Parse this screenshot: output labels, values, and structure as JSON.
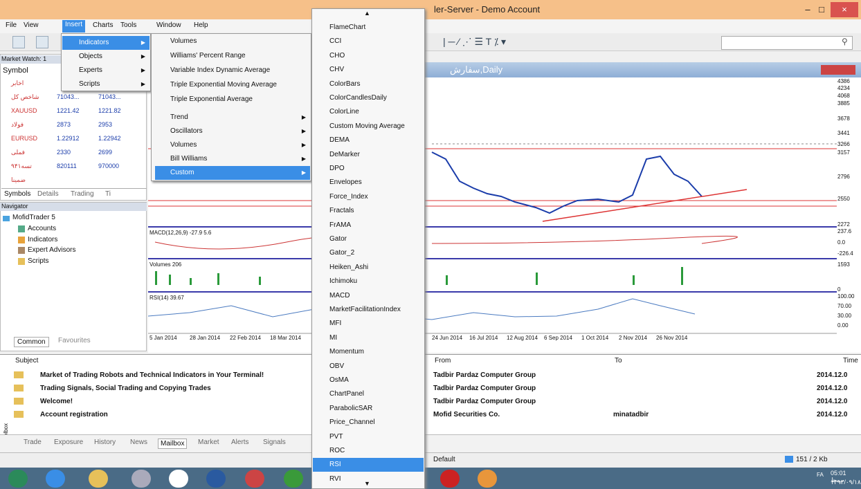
{
  "window": {
    "title": "ler-Server - Demo Account",
    "min": "–",
    "max": "□",
    "close": "×"
  },
  "menubar": [
    "File",
    "View",
    "Insert",
    "Charts",
    "Tools",
    "Window",
    "Help"
  ],
  "insert_menu": [
    "Indicators",
    "Objects",
    "Experts",
    "Scripts"
  ],
  "indicators_menu": {
    "top": [
      "Volumes",
      "Williams' Percent Range",
      "Variable Index Dynamic Average",
      "Triple Exponential Moving Average",
      "Triple Exponential Average"
    ],
    "sub": [
      "Trend",
      "Oscillators",
      "Volumes",
      "Bill Williams",
      "Custom"
    ]
  },
  "custom_menu": [
    "FlameChart",
    "CCI",
    "CHO",
    "CHV",
    "ColorBars",
    "ColorCandlesDaily",
    "ColorLine",
    "Custom Moving Average",
    "DEMA",
    "DeMarker",
    "DPO",
    "Envelopes",
    "Force_Index",
    "Fractals",
    "FrAMA",
    "Gator",
    "Gator_2",
    "Heiken_Ashi",
    "Ichimoku",
    "MACD",
    "MarketFacilitationIndex",
    "MFI",
    "MI",
    "Momentum",
    "OBV",
    "OsMA",
    "ChartPanel",
    "ParabolicSAR",
    "Price_Channel",
    "PVT",
    "ROC",
    "RSI",
    "RVI"
  ],
  "market_watch": {
    "title": "Market Watch: 1",
    "col": "Symbol",
    "rows": [
      {
        "sym": "اخابر",
        "bid": "",
        "ask": ""
      },
      {
        "sym": "شاخص کل",
        "bid": "71043...",
        "ask": "71043..."
      },
      {
        "sym": "XAUUSD",
        "bid": "1221.42",
        "ask": "1221.82"
      },
      {
        "sym": "فولاد",
        "bid": "2873",
        "ask": "2953"
      },
      {
        "sym": "EURUSD",
        "bid": "1.22912",
        "ask": "1.22942"
      },
      {
        "sym": "فملی",
        "bid": "2330",
        "ask": "2699"
      },
      {
        "sym": "تسه۹۴۱",
        "bid": "820111",
        "ask": "970000"
      },
      {
        "sym": "ضمینا",
        "bid": "",
        "ask": ""
      }
    ],
    "tabs": [
      "Symbols",
      "Details",
      "Trading",
      "Ti"
    ]
  },
  "navigator": {
    "title": "Navigator",
    "items": [
      "MofidTrader 5",
      "Accounts",
      "Indicators",
      "Expert Advisors",
      "Scripts"
    ],
    "tabs": [
      "Common",
      "Favourites"
    ]
  },
  "chart": {
    "title": "سفارش,Daily",
    "macd_label": "MACD(12,26,9) -27.9 5.6",
    "vol_label": "Volumes 206",
    "rsi_label": "RSI(14) 39.67",
    "price_ticks": [
      "4386",
      "4234",
      "4068",
      "3885",
      "3678",
      "3441",
      "3266",
      "3157",
      "2796",
      "2550",
      "2272"
    ],
    "macd_ticks": [
      "237.6",
      "0.0",
      "-226.4"
    ],
    "vol_ticks": [
      "1593",
      "0"
    ],
    "rsi_ticks": [
      "100.00",
      "70.00",
      "30.00",
      "0.00"
    ],
    "date_left": [
      "5 Jan 2014",
      "28 Jan 2014",
      "22 Feb 2014",
      "18 Mar 2014"
    ],
    "date_right": [
      "24 Jun 2014",
      "16 Jul 2014",
      "12 Aug 2014",
      "6 Sep 2014",
      "1 Oct 2014",
      "2 Nov 2014",
      "26 Nov 2014"
    ]
  },
  "mailbox": {
    "headers": {
      "subject": "Subject",
      "from": "From",
      "to": "To",
      "time": "Time"
    },
    "rows": [
      {
        "subject": "Market of Trading Robots and Technical Indicators in Your Terminal!",
        "from": "Tadbir Pardaz Computer Group",
        "to": "",
        "time": "2014.12.0"
      },
      {
        "subject": "Trading Signals, Social Trading and Copying Trades",
        "from": "Tadbir Pardaz Computer Group",
        "to": "",
        "time": "2014.12.0"
      },
      {
        "subject": "Welcome!",
        "from": "Tadbir Pardaz Computer Group",
        "to": "",
        "time": "2014.12.0"
      },
      {
        "subject": "Account registration",
        "from": "Mofid Securities Co.",
        "to": "minatadbir",
        "time": "2014.12.0"
      }
    ]
  },
  "bottom_tabs": [
    "Trade",
    "Exposure",
    "History",
    "News",
    "Mailbox",
    "Market",
    "Alerts",
    "Signals"
  ],
  "status": {
    "profile": "Default",
    "traffic": "151 / 2 Kb"
  },
  "toolbox_label": "Toolbox",
  "taskbar": {
    "time": "05:01 ب.ظ",
    "date": "۱۳۹۳/۰۹/۱۸",
    "lang": "FA"
  }
}
